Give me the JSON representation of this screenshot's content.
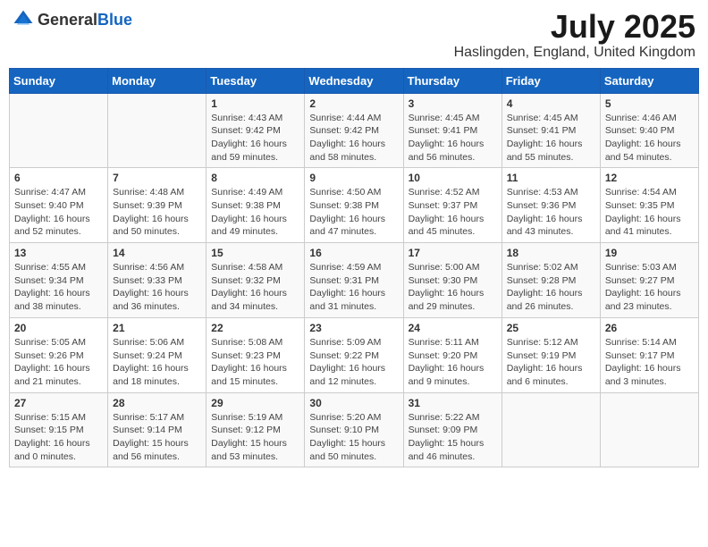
{
  "header": {
    "logo_general": "General",
    "logo_blue": "Blue",
    "main_title": "July 2025",
    "subtitle": "Haslingden, England, United Kingdom"
  },
  "days_of_week": [
    "Sunday",
    "Monday",
    "Tuesday",
    "Wednesday",
    "Thursday",
    "Friday",
    "Saturday"
  ],
  "weeks": [
    [
      {
        "day": "",
        "info": ""
      },
      {
        "day": "",
        "info": ""
      },
      {
        "day": "1",
        "info": "Sunrise: 4:43 AM\nSunset: 9:42 PM\nDaylight: 16 hours and 59 minutes."
      },
      {
        "day": "2",
        "info": "Sunrise: 4:44 AM\nSunset: 9:42 PM\nDaylight: 16 hours and 58 minutes."
      },
      {
        "day": "3",
        "info": "Sunrise: 4:45 AM\nSunset: 9:41 PM\nDaylight: 16 hours and 56 minutes."
      },
      {
        "day": "4",
        "info": "Sunrise: 4:45 AM\nSunset: 9:41 PM\nDaylight: 16 hours and 55 minutes."
      },
      {
        "day": "5",
        "info": "Sunrise: 4:46 AM\nSunset: 9:40 PM\nDaylight: 16 hours and 54 minutes."
      }
    ],
    [
      {
        "day": "6",
        "info": "Sunrise: 4:47 AM\nSunset: 9:40 PM\nDaylight: 16 hours and 52 minutes."
      },
      {
        "day": "7",
        "info": "Sunrise: 4:48 AM\nSunset: 9:39 PM\nDaylight: 16 hours and 50 minutes."
      },
      {
        "day": "8",
        "info": "Sunrise: 4:49 AM\nSunset: 9:38 PM\nDaylight: 16 hours and 49 minutes."
      },
      {
        "day": "9",
        "info": "Sunrise: 4:50 AM\nSunset: 9:38 PM\nDaylight: 16 hours and 47 minutes."
      },
      {
        "day": "10",
        "info": "Sunrise: 4:52 AM\nSunset: 9:37 PM\nDaylight: 16 hours and 45 minutes."
      },
      {
        "day": "11",
        "info": "Sunrise: 4:53 AM\nSunset: 9:36 PM\nDaylight: 16 hours and 43 minutes."
      },
      {
        "day": "12",
        "info": "Sunrise: 4:54 AM\nSunset: 9:35 PM\nDaylight: 16 hours and 41 minutes."
      }
    ],
    [
      {
        "day": "13",
        "info": "Sunrise: 4:55 AM\nSunset: 9:34 PM\nDaylight: 16 hours and 38 minutes."
      },
      {
        "day": "14",
        "info": "Sunrise: 4:56 AM\nSunset: 9:33 PM\nDaylight: 16 hours and 36 minutes."
      },
      {
        "day": "15",
        "info": "Sunrise: 4:58 AM\nSunset: 9:32 PM\nDaylight: 16 hours and 34 minutes."
      },
      {
        "day": "16",
        "info": "Sunrise: 4:59 AM\nSunset: 9:31 PM\nDaylight: 16 hours and 31 minutes."
      },
      {
        "day": "17",
        "info": "Sunrise: 5:00 AM\nSunset: 9:30 PM\nDaylight: 16 hours and 29 minutes."
      },
      {
        "day": "18",
        "info": "Sunrise: 5:02 AM\nSunset: 9:28 PM\nDaylight: 16 hours and 26 minutes."
      },
      {
        "day": "19",
        "info": "Sunrise: 5:03 AM\nSunset: 9:27 PM\nDaylight: 16 hours and 23 minutes."
      }
    ],
    [
      {
        "day": "20",
        "info": "Sunrise: 5:05 AM\nSunset: 9:26 PM\nDaylight: 16 hours and 21 minutes."
      },
      {
        "day": "21",
        "info": "Sunrise: 5:06 AM\nSunset: 9:24 PM\nDaylight: 16 hours and 18 minutes."
      },
      {
        "day": "22",
        "info": "Sunrise: 5:08 AM\nSunset: 9:23 PM\nDaylight: 16 hours and 15 minutes."
      },
      {
        "day": "23",
        "info": "Sunrise: 5:09 AM\nSunset: 9:22 PM\nDaylight: 16 hours and 12 minutes."
      },
      {
        "day": "24",
        "info": "Sunrise: 5:11 AM\nSunset: 9:20 PM\nDaylight: 16 hours and 9 minutes."
      },
      {
        "day": "25",
        "info": "Sunrise: 5:12 AM\nSunset: 9:19 PM\nDaylight: 16 hours and 6 minutes."
      },
      {
        "day": "26",
        "info": "Sunrise: 5:14 AM\nSunset: 9:17 PM\nDaylight: 16 hours and 3 minutes."
      }
    ],
    [
      {
        "day": "27",
        "info": "Sunrise: 5:15 AM\nSunset: 9:15 PM\nDaylight: 16 hours and 0 minutes."
      },
      {
        "day": "28",
        "info": "Sunrise: 5:17 AM\nSunset: 9:14 PM\nDaylight: 15 hours and 56 minutes."
      },
      {
        "day": "29",
        "info": "Sunrise: 5:19 AM\nSunset: 9:12 PM\nDaylight: 15 hours and 53 minutes."
      },
      {
        "day": "30",
        "info": "Sunrise: 5:20 AM\nSunset: 9:10 PM\nDaylight: 15 hours and 50 minutes."
      },
      {
        "day": "31",
        "info": "Sunrise: 5:22 AM\nSunset: 9:09 PM\nDaylight: 15 hours and 46 minutes."
      },
      {
        "day": "",
        "info": ""
      },
      {
        "day": "",
        "info": ""
      }
    ]
  ]
}
